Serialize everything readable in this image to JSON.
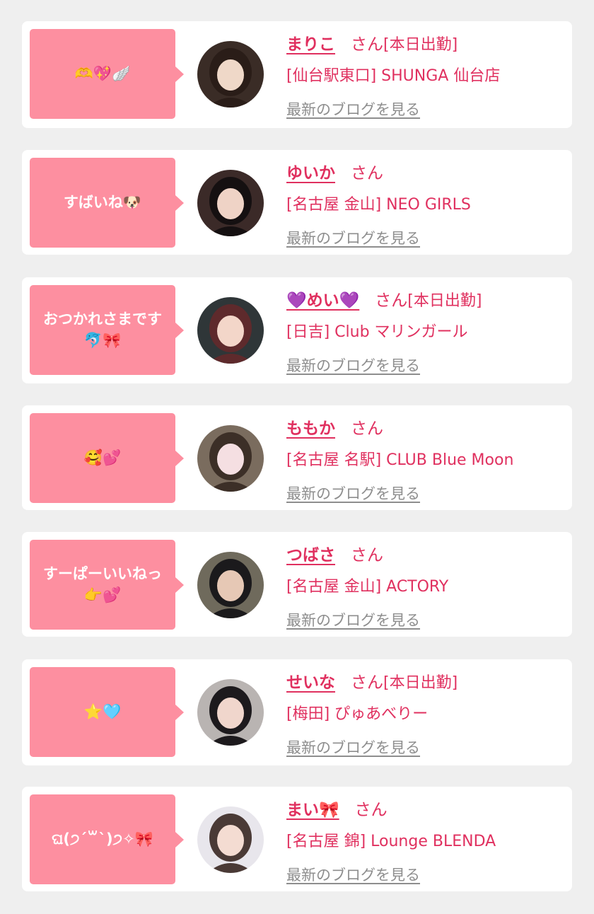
{
  "cards": [
    {
      "bubble": "🫶💖🪽",
      "name": "まりこ",
      "honorific": "さん",
      "status": "[本日出勤]",
      "shop": "[仙台駅東口] SHUNGA 仙台店",
      "blog_link": "最新のブログを見る",
      "avatar_icon": "avatar-photo",
      "colors": {
        "bg": "#3a2c26",
        "hair": "#2a1d18",
        "skin": "#efd8c8"
      }
    },
    {
      "bubble": "すばいね🐶",
      "name": "ゆいか",
      "honorific": "さん",
      "status": "",
      "shop": "[名古屋 金山] NEO GIRLS",
      "blog_link": "最新のブログを見る",
      "avatar_icon": "avatar-photo",
      "colors": {
        "bg": "#3b2a28",
        "hair": "#151011",
        "skin": "#efd3c6"
      }
    },
    {
      "bubble": "おつかれさまです\n🐬🎀",
      "name": "💜めい💜",
      "honorific": "さん",
      "status": "[本日出勤]",
      "shop": "[日吉] Club マリンガール",
      "blog_link": "最新のブログを見る",
      "avatar_icon": "avatar-photo",
      "colors": {
        "bg": "#2f3638",
        "hair": "#5e2a2c",
        "skin": "#f3d6c9"
      }
    },
    {
      "bubble": "🥰💕",
      "name": "ももか",
      "honorific": "さん",
      "status": "",
      "shop": "[名古屋 名駅] CLUB Blue Moon",
      "blog_link": "最新のブログを見る",
      "avatar_icon": "avatar-photo",
      "colors": {
        "bg": "#7a6c5e",
        "hair": "#3c2f27",
        "skin": "#f5dfe2"
      }
    },
    {
      "bubble": "すーぱーいいねっ\n👉💕",
      "name": "つばさ",
      "honorific": "さん",
      "status": "",
      "shop": "[名古屋 金山] ACTORY",
      "blog_link": "最新のブログを見る",
      "avatar_icon": "avatar-photo",
      "colors": {
        "bg": "#6f6a5c",
        "hair": "#1b1a1c",
        "skin": "#e6c8b5"
      }
    },
    {
      "bubble": "⭐️🩵",
      "name": "せいな",
      "honorific": "さん",
      "status": "[本日出勤]",
      "shop": "[梅田] ぴゅあべりー",
      "blog_link": "最新のブログを見る",
      "avatar_icon": "avatar-photo",
      "colors": {
        "bg": "#b9b4b2",
        "hair": "#1d1a1d",
        "skin": "#f0d6cc"
      }
    },
    {
      "bubble": "ଘ(੭ˊ꒳ˋ)੭✧🎀",
      "name": "まい🎀",
      "honorific": "さん",
      "status": "",
      "shop": "[名古屋 錦] Lounge BLENDA",
      "blog_link": "最新のブログを見る",
      "avatar_icon": "avatar-photo",
      "colors": {
        "bg": "#e8e6ec",
        "hair": "#4a3a36",
        "skin": "#f4dcd2"
      }
    }
  ]
}
